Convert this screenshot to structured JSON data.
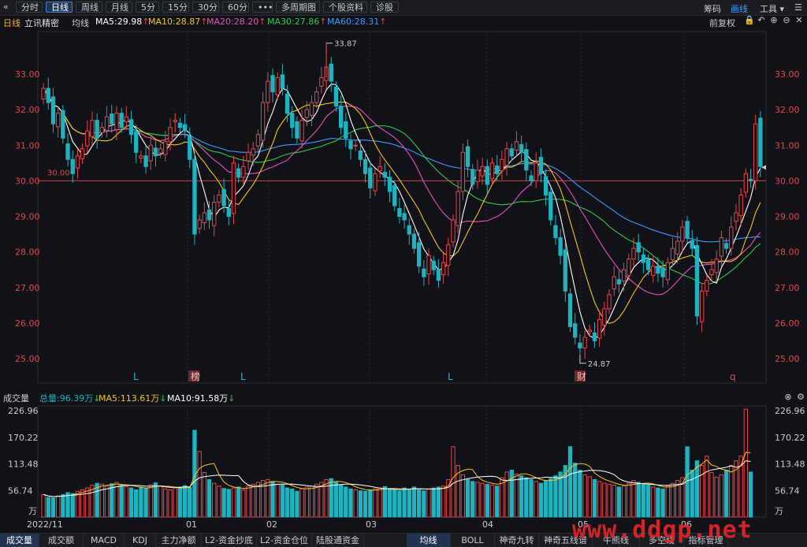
{
  "toolbar": {
    "back_icon": "double-chevron-left-icon",
    "periods": [
      "分时",
      "日线",
      "周线",
      "月线",
      "5分",
      "15分",
      "30分",
      "60分",
      "•••",
      "多周期图",
      "个股资料",
      "诊股"
    ],
    "active_period": "日线",
    "right_items": [
      "筹码",
      "画线",
      "工具"
    ],
    "active_right": "画线"
  },
  "info": {
    "period": "日线",
    "stock_name": "立讯精密",
    "ma_type": "均线",
    "ma5": "MA5:29.98",
    "ma10": "MA10:28.87",
    "ma20": "MA20:28.20",
    "ma30": "MA30:27.86",
    "ma60": "MA60:28.31",
    "adjust": "前复权",
    "colors": {
      "ma5": "#ffffff",
      "ma10": "#f5c518",
      "ma20": "#e84fbf",
      "ma30": "#2ec94a",
      "ma60": "#3c9bff",
      "up": "#e8464b",
      "down": "#1fb3c0"
    }
  },
  "volume_info": {
    "label": "成交量",
    "total": "总量:96.39万",
    "ma5": "MA5:113.61万",
    "ma10": "MA10:91.58万"
  },
  "bottom_tabs": {
    "left": [
      "成交量",
      "成交额",
      "MACD",
      "KDJ",
      "主力净额",
      "L2-资金抄底",
      "L2-资金仓位",
      "陆股通资金"
    ],
    "active_left": "成交量",
    "right": [
      "均线",
      "BOLL",
      "神奇九转",
      "神奇五线谱",
      "牛熊线",
      "多空线",
      "指标管理"
    ],
    "active_right": "均线"
  },
  "watermark": "www.ddgp.net",
  "chart_data": [
    {
      "type": "candlestick",
      "y_ticks": [
        "33.00",
        "32.00",
        "31.00",
        "30.00",
        "29.00",
        "28.00",
        "27.00",
        "26.00",
        "25.00"
      ],
      "ylim": [
        24.7,
        33.5
      ],
      "reference_line": {
        "value": 30.0,
        "label": "30.00"
      },
      "annotations": {
        "high": "33.87",
        "low": "24.87"
      },
      "markers": [
        "L",
        "榜",
        "L",
        "L",
        "财",
        "q"
      ],
      "closes": [
        32.6,
        32.2,
        31.6,
        31.9,
        31.2,
        30.6,
        30.2,
        30.7,
        30.9,
        31.4,
        31.7,
        31.2,
        31.5,
        31.8,
        31.6,
        31.9,
        31.5,
        31.8,
        31.3,
        30.8,
        30.7,
        30.4,
        31.0,
        30.7,
        30.9,
        31.1,
        31.5,
        31.7,
        31.5,
        31.4,
        30.6,
        28.5,
        28.9,
        29.1,
        28.9,
        29.4,
        29.6,
        29.3,
        29.0,
        30.5,
        30.1,
        30.4,
        30.8,
        30.9,
        31.3,
        32.2,
        32.8,
        32.5,
        32.9,
        32.6,
        31.9,
        31.5,
        31.2,
        31.7,
        32.0,
        32.2,
        32.5,
        32.9,
        33.2,
        32.8,
        32.1,
        31.5,
        31.2,
        30.9,
        31.0,
        30.6,
        30.2,
        29.8,
        30.2,
        30.4,
        30.1,
        29.7,
        29.3,
        29.0,
        28.9,
        28.5,
        28.1,
        27.6,
        27.3,
        27.9,
        27.5,
        27.2,
        27.7,
        28.2,
        28.9,
        29.7,
        30.8,
        30.4,
        29.9,
        30.3,
        30.4,
        29.9,
        30.5,
        30.2,
        30.6,
        30.9,
        30.7,
        31.1,
        30.8,
        30.3,
        30.0,
        30.5,
        30.2,
        29.6,
        28.9,
        28.4,
        27.9,
        26.9,
        25.9,
        25.6,
        25.3,
        25.6,
        25.8,
        25.5,
        26.1,
        26.4,
        26.8,
        27.3,
        27.1,
        27.5,
        27.8,
        28.1,
        28.0,
        27.7,
        27.5,
        27.6,
        27.4,
        27.3,
        27.7,
        28.1,
        28.3,
        28.7,
        28.4,
        28.1,
        26.2,
        26.9,
        27.2,
        27.5,
        27.8,
        28.4,
        28.1,
        28.7,
        29.1,
        29.6,
        30.2,
        30.0,
        31.6,
        30.4
      ],
      "x_labels": [
        "2022/11",
        "01",
        "02",
        "03",
        "04",
        "05",
        "06"
      ]
    },
    {
      "type": "bar",
      "name": "成交量",
      "unit": "万",
      "y_ticks": [
        "226.96",
        "170.22",
        "113.48",
        "56.74"
      ],
      "ylim": [
        0,
        226.96
      ],
      "values": [
        48,
        42,
        41,
        45,
        48,
        52,
        50,
        55,
        58,
        62,
        68,
        72,
        70,
        66,
        71,
        74,
        68,
        65,
        62,
        58,
        64,
        61,
        69,
        73,
        66,
        60,
        58,
        62,
        64,
        67,
        63,
        185,
        140,
        95,
        80,
        72,
        66,
        61,
        59,
        62,
        64,
        58,
        66,
        70,
        74,
        78,
        80,
        76,
        70,
        68,
        62,
        60,
        55,
        60,
        64,
        66,
        70,
        74,
        80,
        82,
        74,
        68,
        64,
        60,
        58,
        56,
        55,
        58,
        60,
        62,
        65,
        60,
        58,
        56,
        62,
        60,
        64,
        58,
        56,
        60,
        62,
        64,
        66,
        80,
        150,
        110,
        90,
        80,
        76,
        74,
        72,
        70,
        68,
        66,
        84,
        96,
        100,
        92,
        88,
        84,
        80,
        76,
        72,
        78,
        82,
        88,
        96,
        110,
        150,
        115,
        100,
        90,
        86,
        80,
        76,
        72,
        70,
        68,
        64,
        66,
        72,
        78,
        74,
        70,
        68,
        64,
        62,
        60,
        66,
        72,
        78,
        84,
        150,
        100,
        120,
        110,
        130,
        95,
        85,
        90,
        100,
        110,
        120,
        130,
        230,
        96
      ]
    }
  ]
}
